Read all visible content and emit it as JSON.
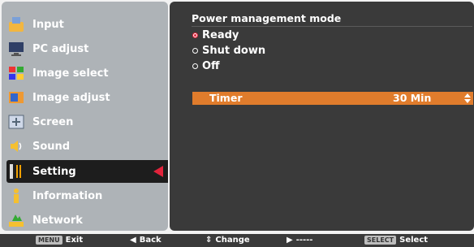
{
  "sidebar": {
    "items": [
      {
        "label": "Input",
        "icon": "input-icon"
      },
      {
        "label": "PC adjust",
        "icon": "monitor-icon"
      },
      {
        "label": "Image select",
        "icon": "image-select-icon"
      },
      {
        "label": "Image adjust",
        "icon": "image-adjust-icon"
      },
      {
        "label": "Screen",
        "icon": "screen-icon"
      },
      {
        "label": "Sound",
        "icon": "speaker-icon"
      },
      {
        "label": "Setting",
        "icon": "setting-icon"
      },
      {
        "label": "Information",
        "icon": "info-icon"
      },
      {
        "label": "Network",
        "icon": "network-icon"
      }
    ],
    "active_index": 6
  },
  "panel": {
    "title": "Power management mode",
    "options": [
      {
        "label": "Ready",
        "selected": true
      },
      {
        "label": "Shut down",
        "selected": false
      },
      {
        "label": "Off",
        "selected": false
      }
    ],
    "timer": {
      "label": "Timer",
      "value": "30 Min"
    }
  },
  "bottombar": {
    "exit": {
      "key": "MENU",
      "label": "Exit"
    },
    "back": {
      "label": "Back"
    },
    "change": {
      "label": "Change"
    },
    "next": {
      "label": "-----"
    },
    "select": {
      "key": "SELECT",
      "label": "Select"
    }
  },
  "colors": {
    "accent": "#e07c2c",
    "selector": "#e2233b",
    "panel": "#3a3a3a",
    "sidebar": "#aeb3b7"
  }
}
